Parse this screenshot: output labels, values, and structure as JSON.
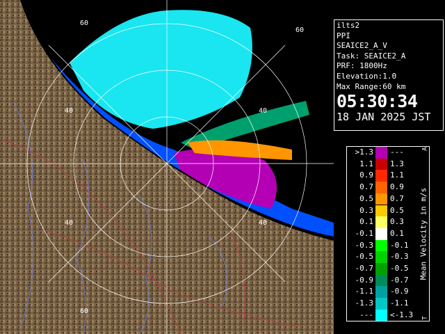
{
  "info": {
    "site": "ilts2",
    "product": "PPI",
    "dataset": "SEAICE2_A_V",
    "task": "Task: SEAICE2_A",
    "prf": "PRF: 1800Hz",
    "elevation": "Elevation:1.0",
    "max_range": "Max Range:60 km",
    "time": "05:30:34",
    "date": "18 JAN 2025 JST"
  },
  "range_labels": [
    "60",
    "60",
    "40",
    "40",
    "40",
    "40",
    "60"
  ],
  "legend": {
    "title": "Mean Velocity in m/s",
    "top_mark": "A",
    "bottom_mark": "T",
    "rows": [
      {
        "a": ">1.3",
        "b": "---",
        "color": "#b400b4"
      },
      {
        "a": "1.1",
        "b": "1.3",
        "color": "#c80000"
      },
      {
        "a": "0.9",
        "b": "1.1",
        "color": "#ff2800"
      },
      {
        "a": "0.7",
        "b": "0.9",
        "color": "#ff6400"
      },
      {
        "a": "0.5",
        "b": "0.7",
        "color": "#ff9600"
      },
      {
        "a": "0.3",
        "b": "0.5",
        "color": "#ffc800"
      },
      {
        "a": "0.1",
        "b": "0.3",
        "color": "#ffff64"
      },
      {
        "a": "-0.1",
        "b": "0.1",
        "color": "#ffffff"
      },
      {
        "a": "-0.3",
        "b": "-0.1",
        "color": "#00ff00"
      },
      {
        "a": "-0.5",
        "b": "-0.3",
        "color": "#00d200"
      },
      {
        "a": "-0.7",
        "b": "-0.5",
        "color": "#00a000"
      },
      {
        "a": "-0.9",
        "b": "-0.7",
        "color": "#008c5a"
      },
      {
        "a": "-1.1",
        "b": "-0.9",
        "color": "#00a0a0"
      },
      {
        "a": "-1.3",
        "b": "-1.1",
        "color": "#00c8c8"
      },
      {
        "a": "---",
        "b": "<-1.3",
        "color": "#00ffff"
      }
    ]
  },
  "colors": {
    "land": "#7a6346",
    "sea_far": "#19e6f0",
    "sea_near": "#0050ff",
    "approach": "#b400b4",
    "coast": "#000000"
  }
}
